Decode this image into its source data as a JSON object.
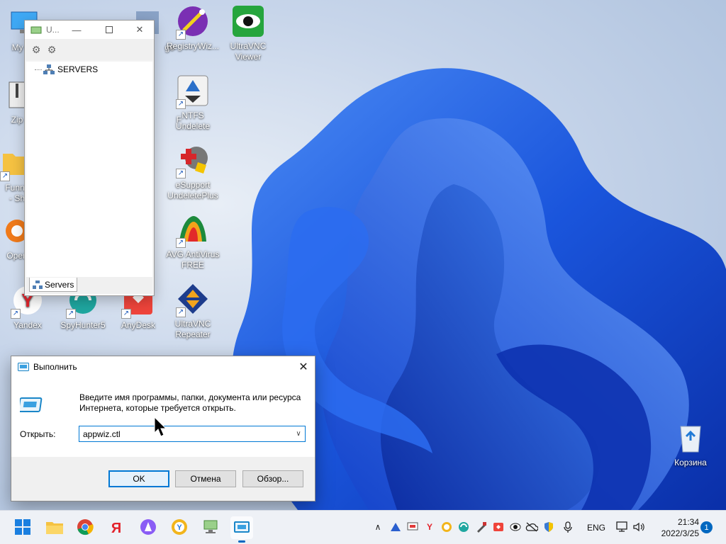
{
  "desktop": {
    "icons": [
      {
        "label": "My Co",
        "icon": "computer-icon"
      },
      {
        "label": "Zip",
        "icon": "zip-icon"
      },
      {
        "label": "Funny",
        "label2": "- Sh",
        "icon": "folder-icon"
      },
      {
        "label": "Open",
        "icon": "app-icon"
      },
      {
        "label": "Yandex",
        "icon": "yandex-icon"
      },
      {
        "label": "SpyHunter5",
        "icon": "spyhunter-icon"
      },
      {
        "label": "AnyDesk",
        "icon": "anydesk-icon"
      },
      {
        "label": "RegistryWiz...",
        "icon": "registry-wizard-icon"
      },
      {
        "label": "UltraVNC",
        "label2": "Viewer",
        "icon": "ultravnc-viewer-icon"
      },
      {
        "label": "NTFS",
        "label2": "Undelete",
        "icon": "ntfs-undelete-icon"
      },
      {
        "label": "eSupport",
        "label2": "UndeletePlus",
        "icon": "undeleteplus-icon"
      },
      {
        "label": "AVG AntiVirus",
        "label2": "FREE",
        "icon": "avg-icon"
      },
      {
        "label": "UltraVNC",
        "label2": "Repeater",
        "icon": "ultravnc-repeater-icon"
      },
      {
        "label": "Корзина",
        "icon": "recycle-bin-icon"
      },
      {
        "label": "ge",
        "icon": "partial-icon"
      },
      {
        "label": "F",
        "icon": "partial-icon"
      }
    ]
  },
  "servers_window": {
    "title": "U...",
    "tree_root": "SERVERS",
    "tab_label": "Servers"
  },
  "run_dialog": {
    "title": "Выполнить",
    "description": "Введите имя программы, папки, документа или ресурса Интернета, которые требуется открыть.",
    "open_label": "Открыть:",
    "open_value": "appwiz.ctl",
    "ok": "OK",
    "cancel": "Отмена",
    "browse": "Обзор..."
  },
  "taskbar": {
    "apps": [
      "start-icon",
      "file-explorer-icon",
      "chrome-icon",
      "yandex-browser-icon",
      "alice-icon",
      "yandex-icon",
      "network-app-icon",
      "run-icon"
    ],
    "language": "ENG",
    "time": "21:34",
    "date": "2022/3/25",
    "notification_count": "1"
  },
  "colors": {
    "accent": "#0078d4",
    "taskbar": "#eef1f6",
    "wallpaper_blue": "#1f5fe0"
  }
}
